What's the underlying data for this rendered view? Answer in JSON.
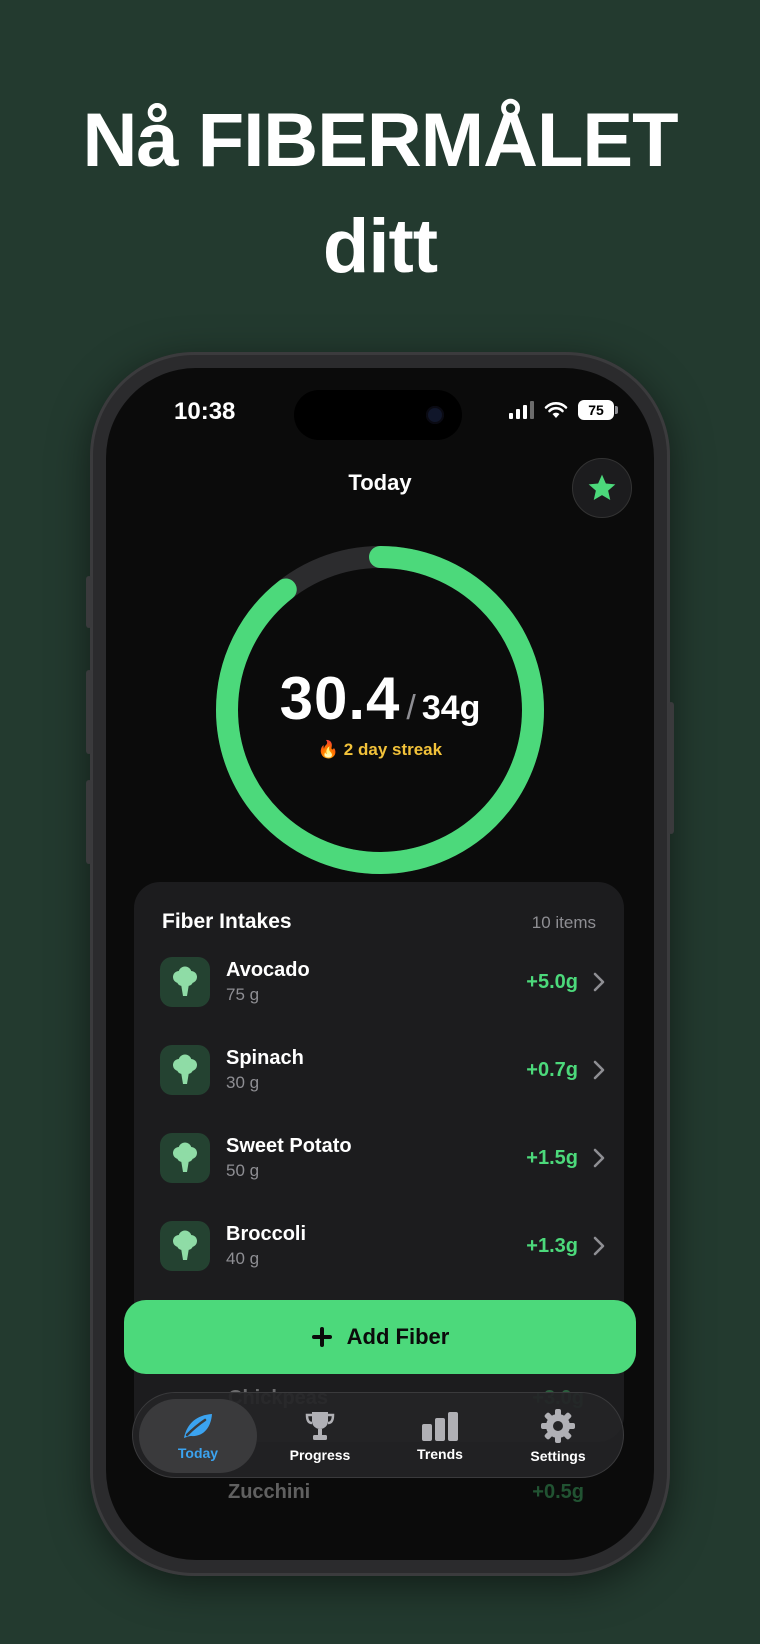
{
  "headline": {
    "line1": "Nå FIBERMÅLET",
    "line2": "ditt"
  },
  "status_bar": {
    "time": "10:38",
    "battery": "75"
  },
  "nav": {
    "title": "Today"
  },
  "progress": {
    "consumed": "30.4",
    "slash": "/",
    "goal": "34g",
    "streak_icon": "🔥",
    "streak": "2 day streak",
    "fraction": 0.894
  },
  "colors": {
    "accent": "#4cd97b",
    "background": "#233a2f",
    "streak": "#f2c23a",
    "active_tab": "#3ba3f0"
  },
  "intakes": {
    "title": "Fiber Intakes",
    "count": "10 items",
    "items": [
      {
        "name": "Avocado",
        "qty": "75 g",
        "fiber": "+5.0g",
        "icon": "broccoli-icon"
      },
      {
        "name": "Spinach",
        "qty": "30 g",
        "fiber": "+0.7g",
        "icon": "broccoli-icon"
      },
      {
        "name": "Sweet Potato",
        "qty": "50 g",
        "fiber": "+1.5g",
        "icon": "broccoli-icon"
      },
      {
        "name": "Broccoli",
        "qty": "40 g",
        "fiber": "+1.3g",
        "icon": "broccoli-icon"
      }
    ],
    "hidden_items": [
      {
        "name": "Chickpeas",
        "fiber": "+3.0g"
      },
      {
        "name": "Zucchini",
        "fiber": "+0.5g"
      }
    ]
  },
  "add_button": {
    "label": "Add Fiber"
  },
  "tabs": [
    {
      "label": "Today",
      "icon": "leaf-icon",
      "active": true
    },
    {
      "label": "Progress",
      "icon": "trophy-icon",
      "active": false
    },
    {
      "label": "Trends",
      "icon": "bar-chart-icon",
      "active": false
    },
    {
      "label": "Settings",
      "icon": "gear-icon",
      "active": false
    }
  ]
}
